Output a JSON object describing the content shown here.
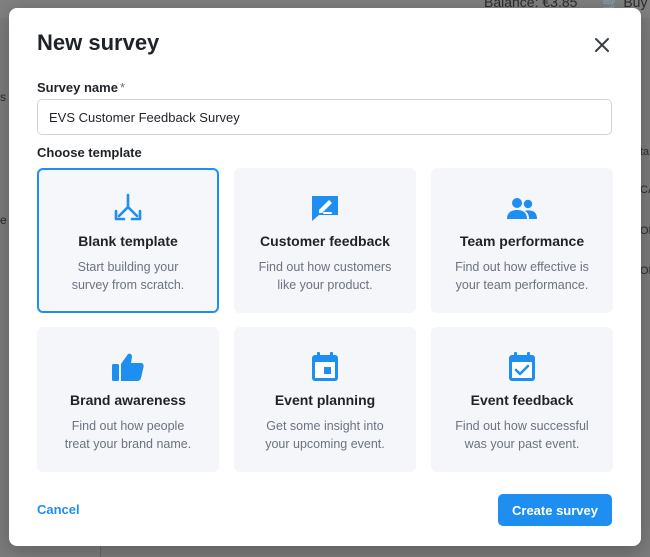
{
  "background": {
    "balance_text": "Balance: €3.85",
    "buy_text": "Buy c",
    "sidebar_fragments": [
      "s",
      "e"
    ],
    "right_fragments": [
      "ta",
      "CA",
      "OR",
      "OR"
    ]
  },
  "modal": {
    "title": "New survey",
    "close_icon": "close-icon",
    "survey_name_label": "Survey name",
    "required_mark": "*",
    "survey_name_value": "EVS Customer Feedback Survey",
    "choose_template_label": "Choose template",
    "templates": [
      {
        "title": "Blank template",
        "desc_line1": "Start building your",
        "desc_line2": "survey from scratch.",
        "icon": "split-arrows-icon",
        "selected": true
      },
      {
        "title": "Customer feedback",
        "desc_line1": "Find out how customers",
        "desc_line2": "like your product.",
        "icon": "feedback-edit-icon",
        "selected": false
      },
      {
        "title": "Team performance",
        "desc_line1": "Find out how effective is",
        "desc_line2": "your team performance.",
        "icon": "people-icon",
        "selected": false
      },
      {
        "title": "Brand awareness",
        "desc_line1": "Find out how people",
        "desc_line2": "treat your brand name.",
        "icon": "thumbs-up-icon",
        "selected": false
      },
      {
        "title": "Event planning",
        "desc_line1": "Get some insight into",
        "desc_line2": "your upcoming event.",
        "icon": "calendar-icon",
        "selected": false
      },
      {
        "title": "Event feedback",
        "desc_line1": "Find out how successful",
        "desc_line2": "was your past event.",
        "icon": "calendar-check-icon",
        "selected": false
      }
    ],
    "cancel_label": "Cancel",
    "create_label": "Create survey"
  },
  "colors": {
    "accent": "#1f8ef1",
    "card_bg": "#f5f6fa",
    "overlay": "#7f7f7f"
  }
}
